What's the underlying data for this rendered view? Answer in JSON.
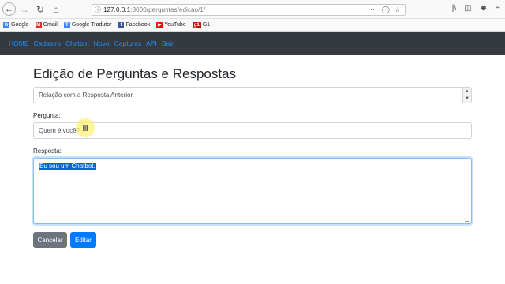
{
  "browser": {
    "url_host": "127.0.0.1",
    "url_path": ":8000/perguntas/edicao/1/",
    "bookmarks": [
      {
        "label": "Google",
        "icon": "google-icon",
        "color": "#4285f4"
      },
      {
        "label": "Gmail",
        "icon": "gmail-icon",
        "color": "#d93025"
      },
      {
        "label": "Google Tradutor",
        "icon": "translate-icon",
        "color": "#4285f4"
      },
      {
        "label": "Facebook",
        "icon": "facebook-icon",
        "color": "#3b5998"
      },
      {
        "label": "YouTube",
        "icon": "youtube-icon",
        "color": "#ff0000"
      },
      {
        "label": "G1",
        "icon": "g1-icon",
        "color": "#c4170c"
      }
    ]
  },
  "navbar": {
    "items": [
      "HOME",
      "Cadastro",
      "Chatbot",
      "Novo",
      "Capturas",
      "API",
      "Sair"
    ],
    "link_color": "#1e90ff",
    "background": "#343a40"
  },
  "form": {
    "title": "Edição de Perguntas e Respostas",
    "select_value": "Relação com a Resposta Anterior",
    "question_label": "Pergunta:",
    "question_value": "Quem é você?",
    "answer_label": "Resposta:",
    "answer_value": "Eu sou um Chatbot.",
    "cancel_label": "Cancelar",
    "save_label": "Editar"
  }
}
